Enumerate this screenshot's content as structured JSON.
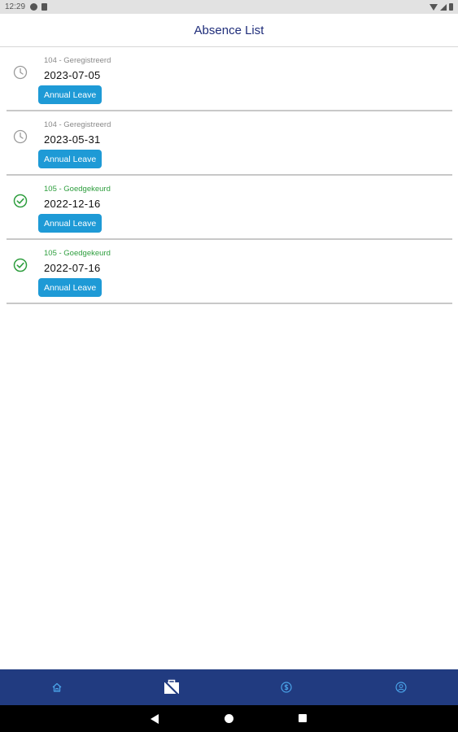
{
  "status_bar": {
    "time": "12:29"
  },
  "header": {
    "title": "Absence List"
  },
  "absences": [
    {
      "status_label": "104 - Geregistreerd",
      "status": "pending",
      "date": "2023-07-05",
      "type": "Annual Leave",
      "icon": "clock-icon"
    },
    {
      "status_label": "104 - Geregistreerd",
      "status": "pending",
      "date": "2023-05-31",
      "type": "Annual Leave",
      "icon": "clock-icon"
    },
    {
      "status_label": "105 - Goedgekeurd",
      "status": "approved",
      "date": "2022-12-16",
      "type": "Annual Leave",
      "icon": "check-circle-icon"
    },
    {
      "status_label": "105 - Goedgekeurd",
      "status": "approved",
      "date": "2022-07-16",
      "type": "Annual Leave",
      "icon": "check-circle-icon"
    }
  ],
  "bottom_nav": {
    "items": [
      {
        "icon": "home-icon",
        "active": false
      },
      {
        "icon": "absence-icon",
        "active": true
      },
      {
        "icon": "dollar-icon",
        "active": false
      },
      {
        "icon": "user-icon",
        "active": false
      }
    ]
  },
  "colors": {
    "header_title": "#1f2d7a",
    "badge": "#1e9ad6",
    "approved": "#2e9e3e",
    "pending": "#8a8a8a",
    "bottom_nav_bg": "#213b80",
    "nav_icon": "#4aa3e8"
  }
}
